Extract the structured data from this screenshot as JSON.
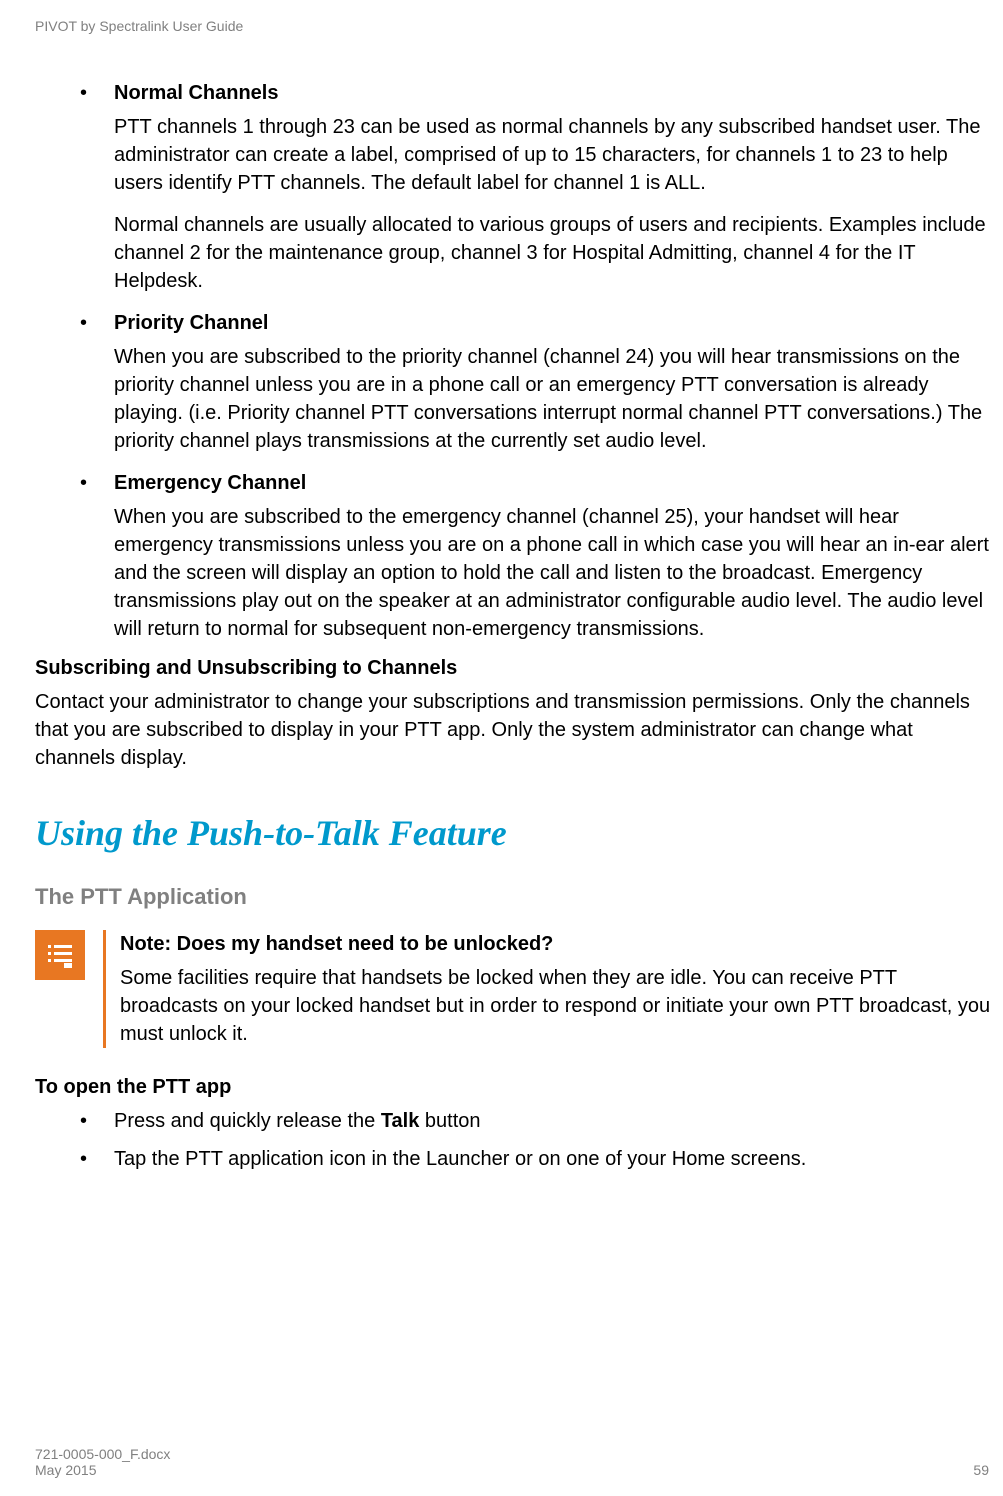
{
  "header": {
    "title": "PIVOT by Spectralink User Guide"
  },
  "sections": {
    "normal": {
      "heading": "Normal Channels",
      "p1": "PTT channels 1 through 23 can be used as normal channels by any subscribed handset user.  The administrator can create a label, comprised of up to 15 characters, for channels 1 to 23 to help users identify PTT channels. The default label for channel 1 is ALL.",
      "p2": "Normal channels are usually allocated to various groups of users and recipients. Examples include channel 2 for the maintenance group, channel 3 for Hospital Admitting, channel 4 for the IT Helpdesk."
    },
    "priority": {
      "heading": "Priority Channel",
      "p1": "When you are subscribed to the priority channel (channel 24) you will hear transmissions on the priority channel unless you are in a phone call or an emergency PTT conversation is already playing. (i.e. Priority channel PTT conversations interrupt normal channel PTT conversations.)  The priority channel plays transmissions at the currently set audio level."
    },
    "emergency": {
      "heading": "Emergency Channel",
      "p1": "When you are subscribed to the emergency channel (channel 25), your handset will hear emergency transmissions unless you are on a phone call in which case you will hear an in-ear alert and the screen will display an option to hold the call and listen to the broadcast. Emergency transmissions play out on the speaker at an administrator configurable audio level. The audio level will return to normal for subsequent non-emergency transmissions."
    },
    "subscribe": {
      "heading": "Subscribing and Unsubscribing to Channels",
      "p1": "Contact your administrator to change your subscriptions and transmission permissions. Only the channels that you are subscribed to display in your PTT app. Only the system administrator can change what channels display."
    },
    "ptt_feature": {
      "title": "Using the Push-to-Talk Feature",
      "sub_title": "The PTT Application"
    },
    "note": {
      "title": "Note: Does my handset need to be unlocked?",
      "body": "Some facilities require that handsets be locked when they are idle. You can receive PTT broadcasts on your locked handset but in order to respond or initiate your own PTT broadcast, you must unlock it."
    },
    "open_ptt": {
      "heading": "To open the PTT app",
      "b1_pre": "Press and quickly release the ",
      "b1_bold": "Talk",
      "b1_post": " button",
      "b2": "Tap the PTT application icon in the Launcher or on one of your Home screens."
    }
  },
  "footer": {
    "doc_number": "721-0005-000_F.docx",
    "date": "May 2015",
    "page": "59"
  }
}
